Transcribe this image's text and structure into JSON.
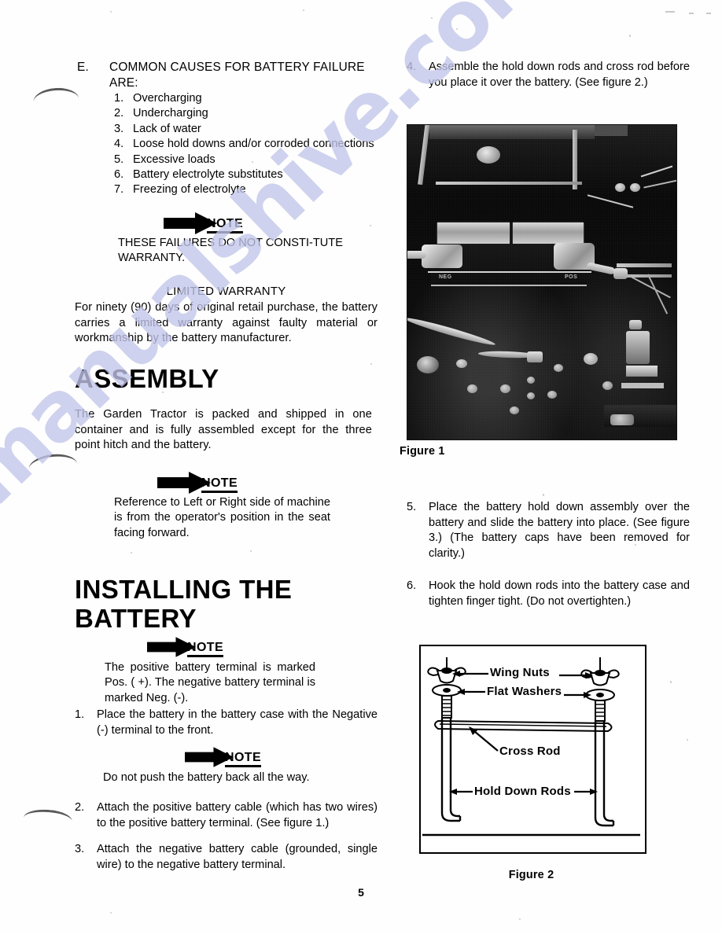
{
  "page": {
    "number": "5",
    "watermark": "manualshive.com"
  },
  "left_column": {
    "item_e": {
      "marker": "E.",
      "text": "COMMON CAUSES FOR BATTERY FAILURE ARE:"
    },
    "causes": [
      {
        "num": "1.",
        "text": "Overcharging"
      },
      {
        "num": "2.",
        "text": "Undercharging"
      },
      {
        "num": "3.",
        "text": "Lack of water"
      },
      {
        "num": "4.",
        "text": "Loose hold downs and/or corroded connections"
      },
      {
        "num": "5.",
        "text": "Excessive loads"
      },
      {
        "num": "6.",
        "text": "Battery electrolyte substitutes"
      },
      {
        "num": "7.",
        "text": "Freezing of electrolyte"
      }
    ],
    "note_1": {
      "label": "NOTE",
      "text": "THESE FAILURES DO NOT CONSTI-TUTE WARRANTY."
    },
    "warranty": {
      "heading": "LIMITED WARRANTY",
      "text": "For ninety (90) days of original retail purchase, the battery carries a limited warranty against faulty material or workmanship by the battery manufacturer."
    },
    "assembly": {
      "heading": "ASSEMBLY",
      "text": "The Garden Tractor is packed and shipped in one container and is fully assembled except for the three point hitch and the battery."
    },
    "note_2": {
      "label": "NOTE",
      "text": "Reference to Left or Right side of machine is from the operator's position in the seat facing forward."
    },
    "installing": {
      "heading_line_1": "INSTALLING THE",
      "heading_line_2": "BATTERY"
    },
    "note_3": {
      "label": "NOTE",
      "text": "The positive battery terminal is marked Pos. ( +). The negative battery terminal is marked Neg. (-)."
    },
    "step_1": {
      "num": "1.",
      "text": "Place the battery in the battery case with the Negative (-) terminal to the front."
    },
    "note_4": {
      "label": "NOTE",
      "text": "Do not push the battery back all the way."
    },
    "step_2": {
      "num": "2.",
      "text": "Attach the positive battery cable (which has two wires) to the positive battery terminal. (See figure 1.)"
    },
    "step_3": {
      "num": "3.",
      "text": "Attach the negative battery cable (grounded, single wire) to the negative battery terminal."
    }
  },
  "right_column": {
    "step_4": {
      "num": "4.",
      "text": "Assemble the hold down rods and cross rod before you place it over the battery. (See figure 2.)"
    },
    "figure_1": {
      "caption": "Figure 1",
      "photo_labels": {
        "negative": "NEG",
        "positive": "POS"
      }
    },
    "step_5": {
      "num": "5.",
      "text": "Place the battery hold down assembly over the battery and slide the battery into place. (See figure 3.) (The battery caps have been removed for clarity.)"
    },
    "step_6": {
      "num": "6.",
      "text": "Hook the hold down rods into the battery case and tighten finger tight. (Do not overtighten.)"
    },
    "figure_2": {
      "caption": "Figure 2",
      "labels": {
        "wing_nuts": "Wing Nuts",
        "flat_washers": "Flat Washers",
        "cross_rod": "Cross Rod",
        "hold_down_rods": "Hold Down Rods"
      }
    }
  }
}
